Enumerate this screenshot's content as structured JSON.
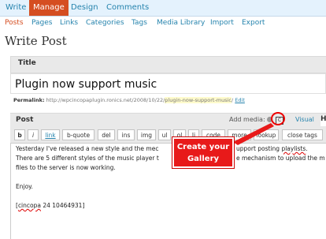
{
  "topnav": {
    "tabs": [
      "Write",
      "Manage",
      "Design",
      "Comments"
    ],
    "active": "Manage"
  },
  "subnav": {
    "items": [
      "Posts",
      "Pages",
      "Links",
      "Categories",
      "Tags",
      "Media Library",
      "Import",
      "Export"
    ],
    "active": "Posts"
  },
  "page_title": "Write Post",
  "title_box": {
    "label": "Title",
    "value": "Plugin now support music"
  },
  "permalink": {
    "label": "Permalink:",
    "base": "http://wpcincopaplugin.ronics.net/2008/10/22/",
    "slug": "plugin-now-support-music",
    "trail": "/",
    "edit": "Edit"
  },
  "post_box": {
    "label": "Post",
    "add_media": "Add media:",
    "visual_tab": "Visual",
    "html_tab": "H"
  },
  "quicktags": [
    "b",
    "i",
    "link",
    "b-quote",
    "del",
    "ins",
    "img",
    "ul",
    "ol",
    "li",
    "code",
    "more",
    "lookup",
    "close tags"
  ],
  "editor": {
    "line1": "Yesterday I've released a new style and the mec",
    "line1b": "upport posting ",
    "line1c": "playlists",
    "line1d": ".",
    "line2": "There are 5 different styles of the music player t",
    "line2b": "e mechanism to upload the m",
    "line3": "files to the server is now working.",
    "line4": "Enjoy.",
    "line5a": "[",
    "line5b": "cincopa",
    "line5c": " 24 10464931]"
  },
  "callout": {
    "line1": "Create your",
    "line2": "Gallery"
  },
  "colors": {
    "accent": "#d54e21",
    "link": "#2583ad",
    "callout": "#e81a1a"
  }
}
